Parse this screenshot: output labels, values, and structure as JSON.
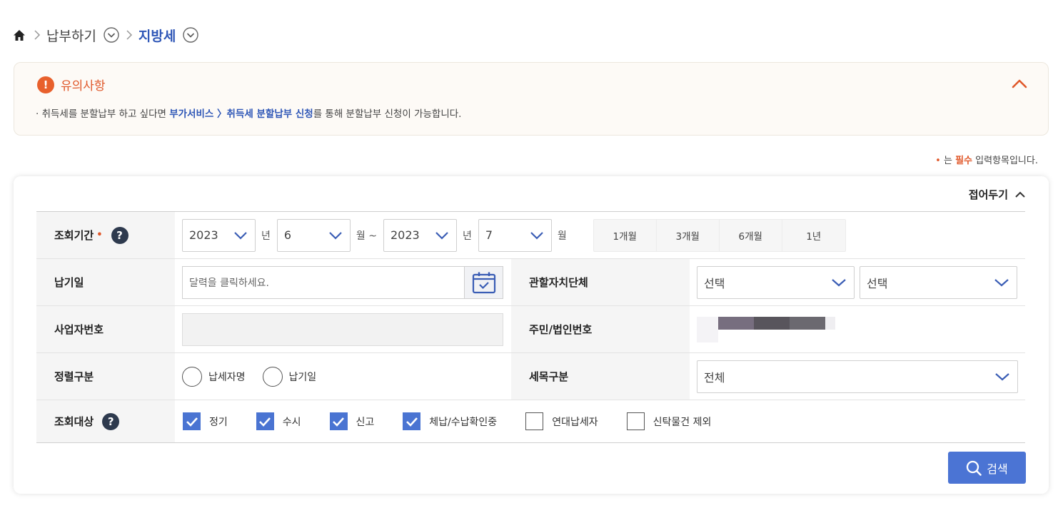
{
  "breadcrumb": {
    "items": [
      {
        "label": "납부하기"
      },
      {
        "label": "지방세"
      }
    ]
  },
  "notice": {
    "icon": "!",
    "title": "유의사항",
    "body_prefix": "· 취득세를 분할납부 하고 싶다면 ",
    "body_link": "부가서비스 〉취득세 분할납부 신청",
    "body_suffix": "를 통해 분할납부 신청이 가능합니다."
  },
  "required_note": {
    "dot": "•",
    "prefix": " 는 ",
    "req": "필수",
    "suffix": " 입력항목입니다."
  },
  "panel": {
    "fold_label": "접어두기"
  },
  "form": {
    "period": {
      "label": "조회기간",
      "required_dot": "•",
      "help": "?",
      "from_year": "2023",
      "year_unit": "년",
      "from_month": "6",
      "month_unit_tilde": "월 ~",
      "to_year": "2023",
      "to_month": "7",
      "month_unit": "월",
      "quick": [
        "1개월",
        "3개월",
        "6개월",
        "1년"
      ]
    },
    "due_date": {
      "label": "납기일",
      "placeholder": "달력을 클릭하세요."
    },
    "jurisdiction": {
      "label": "관할자치단체",
      "select1": "선택",
      "select2": "선택"
    },
    "business_no": {
      "label": "사업자번호"
    },
    "resident_no": {
      "label": "주민/법인번호"
    },
    "sort": {
      "label": "정렬구분",
      "options": [
        "납세자명",
        "납기일"
      ]
    },
    "tax_item": {
      "label": "세목구분",
      "value": "전체"
    },
    "target": {
      "label": "조회대상",
      "help": "?",
      "options": [
        {
          "label": "정기",
          "checked": true
        },
        {
          "label": "수시",
          "checked": true
        },
        {
          "label": "신고",
          "checked": true
        },
        {
          "label": "체납/수납확인중",
          "checked": true
        },
        {
          "label": "연대납세자",
          "checked": false
        },
        {
          "label": "신탁물건 제외",
          "checked": false
        }
      ]
    }
  },
  "search_button": {
    "label": "검색"
  },
  "colors": {
    "accent_blue": "#4b74d4",
    "notice_orange": "#e8602c",
    "link_blue": "#2f57b7"
  }
}
